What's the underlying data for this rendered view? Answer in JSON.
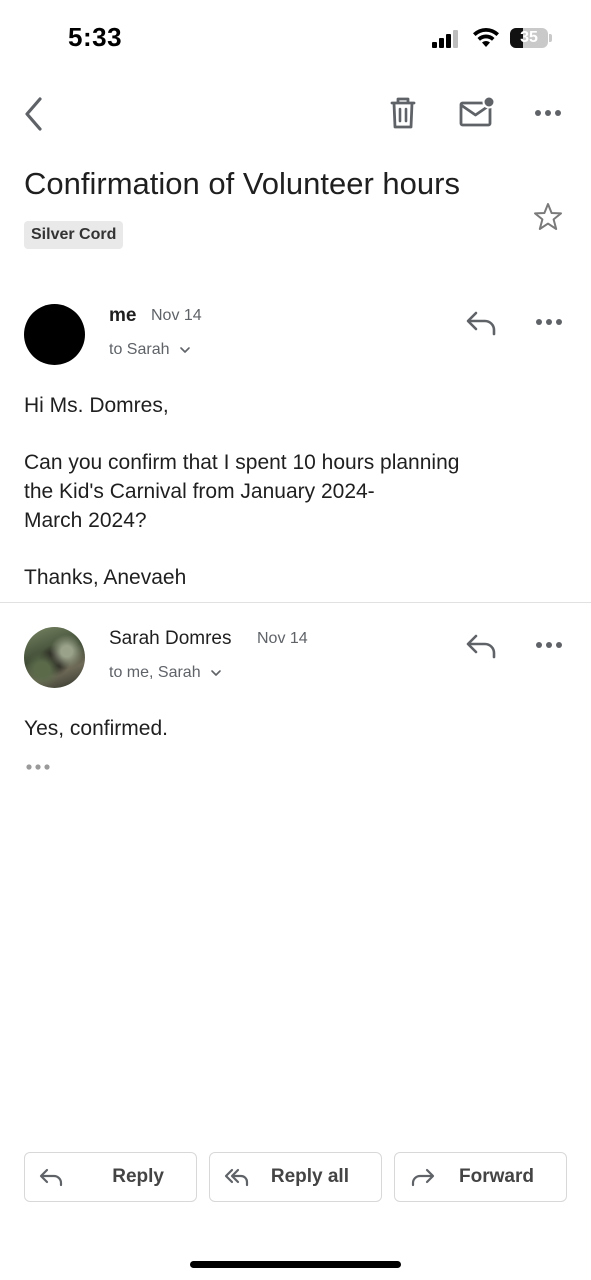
{
  "status_bar": {
    "time": "5:33",
    "battery": "35",
    "battery_level_percent": 35
  },
  "toolbar": {
    "back_icon": "chevron-left-icon",
    "delete_icon": "trash-icon",
    "mark_unread_icon": "mail-unread-icon",
    "more_icon": "more-horizontal-icon"
  },
  "email": {
    "subject": "Confirmation of Volunteer hours",
    "label": "Silver Cord",
    "star_icon": "star-outline-icon"
  },
  "messages": [
    {
      "sender": "me",
      "date": "Nov 14",
      "recipients": "to Sarah",
      "body": [
        "Hi Ms. Domres,",
        "Can you confirm that I spent 10 hours planning",
        "the Kid's Carnival from January 2024-",
        "March 2024?",
        "Thanks, Anevaeh"
      ]
    },
    {
      "sender": "Sarah Domres",
      "date": "Nov 14",
      "recipients": "to me, Sarah",
      "body": [
        "Yes, confirmed."
      ]
    }
  ],
  "actions": {
    "reply": "Reply",
    "reply_all": "Reply all",
    "forward": "Forward"
  },
  "colors": {
    "text_primary": "#1f1f1f",
    "text_secondary": "#5f6368",
    "icon_gray": "#5f6368",
    "chip_bg": "#e9e9e9",
    "divider": "#e1e1e1"
  }
}
